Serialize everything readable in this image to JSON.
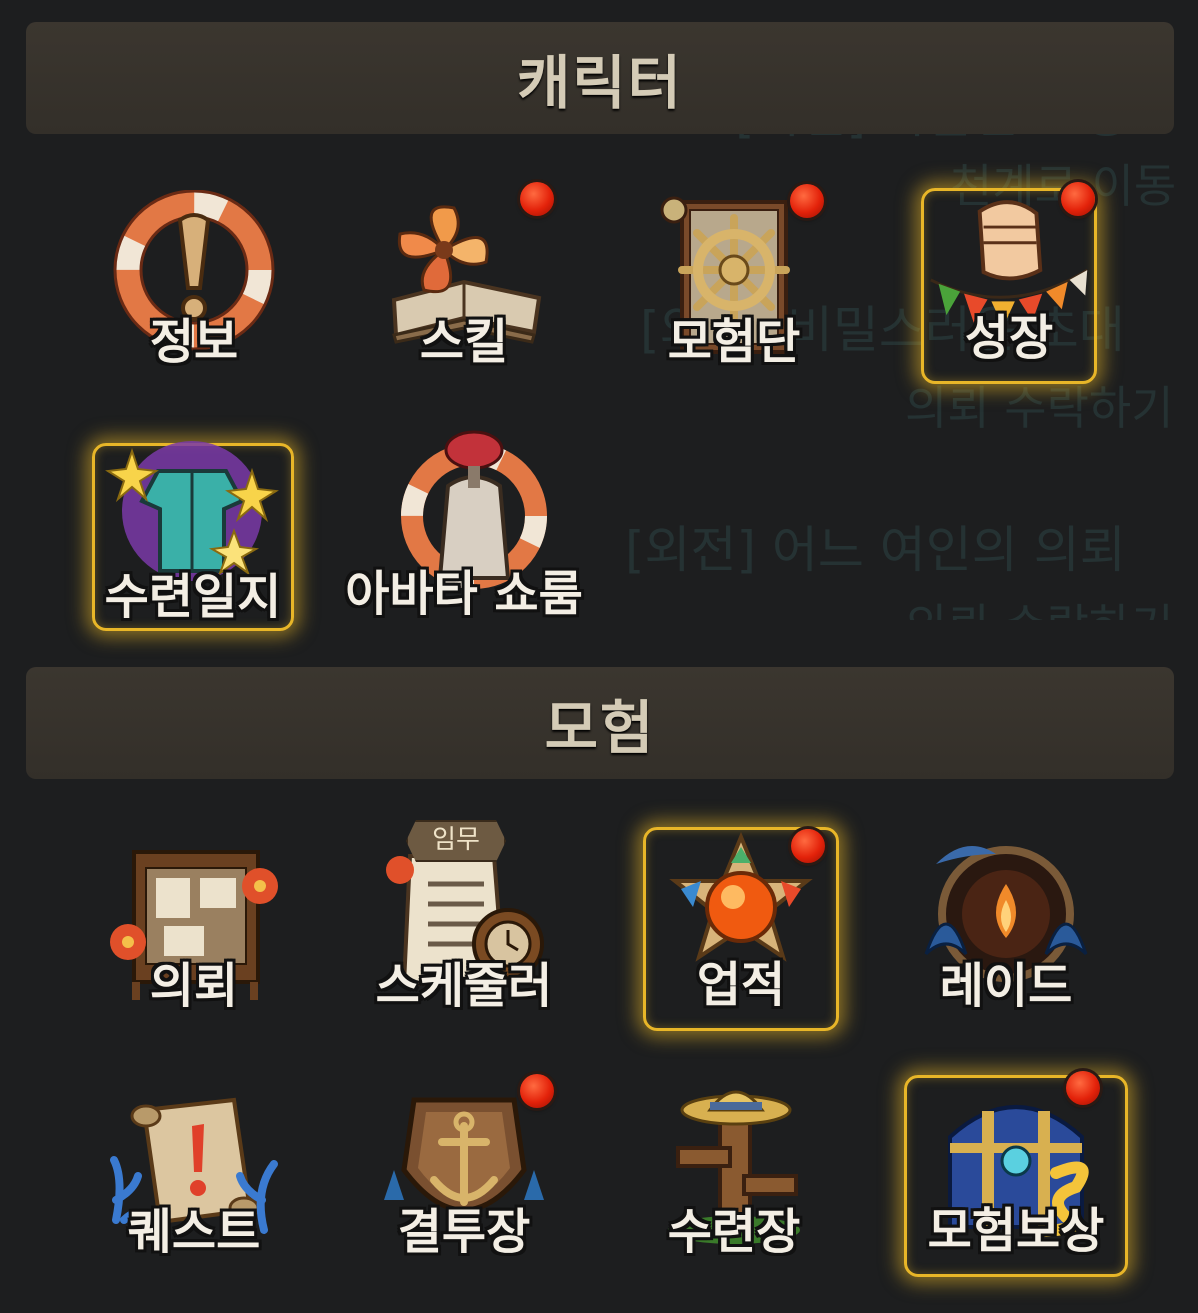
{
  "background_text": {
    "line1": "[외전] 다급한 요청",
    "line2": "천계로 이동",
    "line3": "[외전] 비밀스러운 초대",
    "line4": "의뢰 수락하기",
    "line5": "[외전] 어느 여인의 의뢰",
    "line6": "의뢰 수락하기"
  },
  "sections": {
    "character": {
      "title": "캐릭터"
    },
    "adventure": {
      "title": "모험"
    }
  },
  "character_items": [
    {
      "label": "정보",
      "icon": "lifebuoy-exclamation-icon",
      "notification": false,
      "highlighted": false
    },
    {
      "label": "스킬",
      "icon": "pinwheel-book-icon",
      "notification": true,
      "highlighted": false
    },
    {
      "label": "모험단",
      "icon": "ship-wheel-icon",
      "notification": true,
      "highlighted": false
    },
    {
      "label": "성장",
      "icon": "fist-bunting-icon",
      "notification": true,
      "highlighted": true
    },
    {
      "label": "수련일지",
      "icon": "sparkling-outfit-icon",
      "notification": false,
      "highlighted": true
    },
    {
      "label": "아바타 쇼룸",
      "icon": "avatar-lifebuoy-icon",
      "notification": false,
      "highlighted": false
    }
  ],
  "adventure_items": [
    {
      "label": "의뢰",
      "icon": "request-board-icon",
      "notification": false,
      "highlighted": false
    },
    {
      "label": "스케줄러",
      "icon": "scheduler-scroll-icon",
      "notification": false,
      "highlighted": false,
      "tag": "임무"
    },
    {
      "label": "업적",
      "icon": "achievement-medal-icon",
      "notification": true,
      "highlighted": true
    },
    {
      "label": "레이드",
      "icon": "raid-wave-icon",
      "notification": false,
      "highlighted": false
    },
    {
      "label": "퀘스트",
      "icon": "quest-scroll-icon",
      "notification": false,
      "highlighted": false
    },
    {
      "label": "결투장",
      "icon": "anchor-shield-icon",
      "notification": true,
      "highlighted": false
    },
    {
      "label": "수련장",
      "icon": "training-dummy-icon",
      "notification": false,
      "highlighted": false
    },
    {
      "label": "모험보상",
      "icon": "treasure-chest-icon",
      "notification": true,
      "highlighted": true
    }
  ],
  "colors": {
    "background": "#1d1e1f",
    "header_bg": "#38332c",
    "highlight_gold": "#e8b628",
    "notification_red": "#e3220a"
  }
}
